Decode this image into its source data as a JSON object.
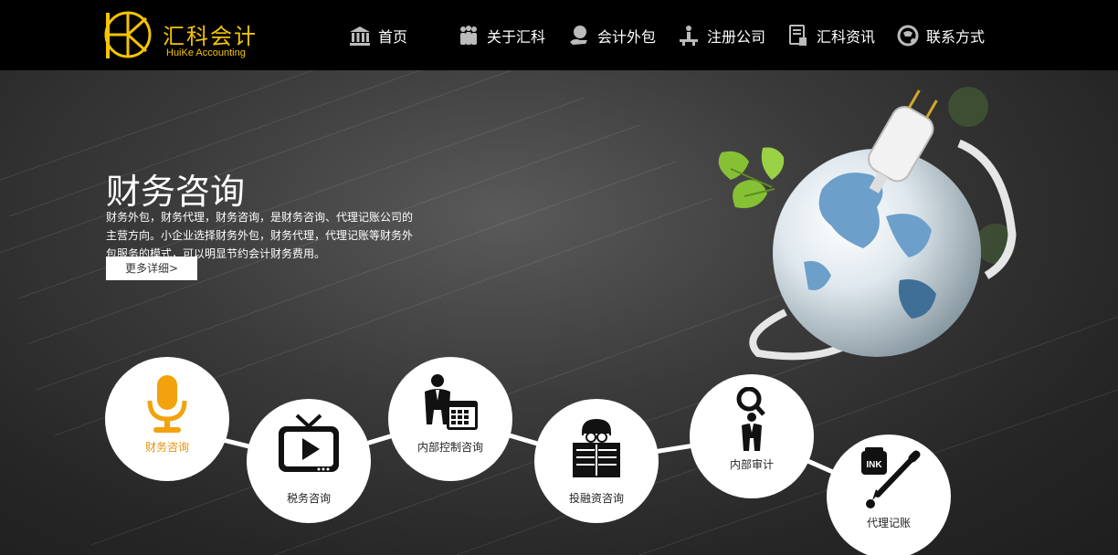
{
  "brand": {
    "name_cn": "汇科会计",
    "name_en": "HuiKe Accounting",
    "color": "#f5c400"
  },
  "nav": {
    "items": [
      {
        "label": "首页",
        "icon": "home-icon"
      },
      {
        "label": "关于汇科",
        "icon": "people-icon"
      },
      {
        "label": "会计外包",
        "icon": "hand-globe-icon"
      },
      {
        "label": "注册公司",
        "icon": "person-desk-icon"
      },
      {
        "label": "汇科资讯",
        "icon": "document-hand-icon"
      },
      {
        "label": "联系方式",
        "icon": "phone-icon"
      }
    ]
  },
  "hero": {
    "title": "财务咨询",
    "description": "财务外包，财务代理，财务咨询，是财务咨询、代理记账公司的主营方向。小企业选择财务外包，财务代理，代理记账等财务外包服务的模式，可以明显节约会计财务费用。",
    "more_label": "更多详细>"
  },
  "services": [
    {
      "label": "财务咨询",
      "icon": "microphone-icon",
      "active": true
    },
    {
      "label": "税务咨询",
      "icon": "tv-play-icon",
      "active": false
    },
    {
      "label": "内部控制咨询",
      "icon": "businessman-calendar-icon",
      "active": false
    },
    {
      "label": "投融资咨询",
      "icon": "reader-newspaper-icon",
      "active": false
    },
    {
      "label": "内部审计",
      "icon": "magnifier-person-icon",
      "active": false
    },
    {
      "label": "代理记账",
      "icon": "ink-pen-icon",
      "active": false
    }
  ],
  "colors": {
    "header_bg": "#000000",
    "accent": "#f5c400",
    "active_service": "#e8900a"
  }
}
